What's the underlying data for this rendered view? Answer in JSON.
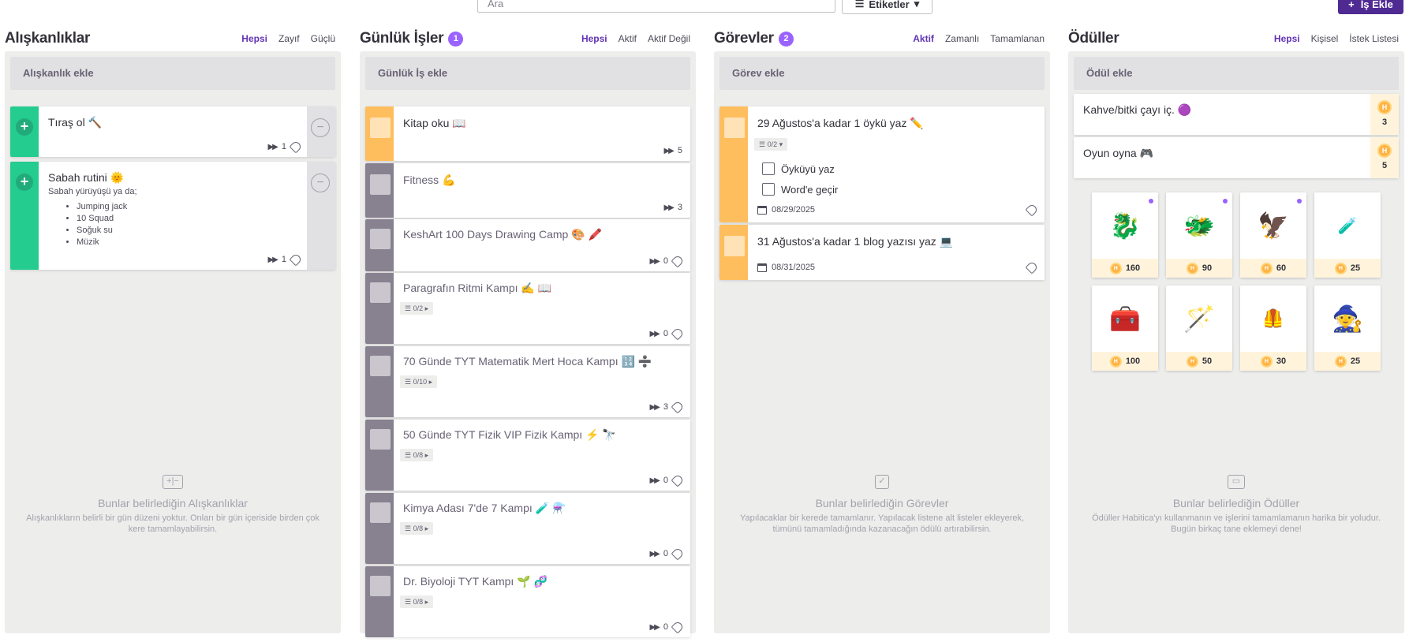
{
  "toolbar": {
    "search_placeholder": "Ara",
    "tags_label": "Etiketler",
    "add_task_label": "İş Ekle"
  },
  "habits": {
    "title": "Alışkanlıklar",
    "filters": [
      "Hepsi",
      "Zayıf",
      "Güçlü"
    ],
    "add_label": "Alışkanlık ekle",
    "items": [
      {
        "title": "Tıraş ol 🔨",
        "count": "1"
      },
      {
        "title": "Sabah rutini 🌞",
        "note": "Sabah yürüyüşü ya da;",
        "list": [
          "Jumping jack",
          "10 Squad",
          "Soğuk su",
          "Müzik"
        ],
        "count": "1"
      }
    ],
    "empty_title": "Bunlar belirlediğin Alışkanlıklar",
    "empty_text": "Alışkanlıkların belirli bir gün düzeni yoktur. Onları bir gün içeriside birden çok kere tamamlayabilirsin."
  },
  "dailies": {
    "title": "Günlük İşler",
    "badge": "1",
    "filters": [
      "Hepsi",
      "Aktif",
      "Aktif Değil"
    ],
    "add_label": "Günlük İş ekle",
    "items": [
      {
        "title": "Kitap oku 📖",
        "streak": "5"
      },
      {
        "title": "Fitness 💪",
        "streak": "3"
      },
      {
        "title": "KeshArt 100 Days Drawing Camp 🎨 🖍️",
        "streak": "0"
      },
      {
        "title": "Paragrafın Ritmi Kampı ✍️ 📖",
        "checklist": "0/2",
        "streak": "0"
      },
      {
        "title": "70 Günde TYT Matematik Mert Hoca Kampı 🔢 ➗",
        "checklist": "0/10",
        "streak": "3"
      },
      {
        "title": "50 Günde TYT Fizik VIP Fizik Kampı ⚡ 🔭",
        "checklist": "0/8",
        "streak": "0"
      },
      {
        "title": "Kimya Adası 7'de 7 Kampı 🧪 ⚗️",
        "checklist": "0/8",
        "streak": "0"
      },
      {
        "title": "Dr. Biyoloji TYT Kampı 🌱 🧬",
        "checklist": "0/8",
        "streak": "0"
      }
    ]
  },
  "todos": {
    "title": "Görevler",
    "badge": "2",
    "filters": [
      "Aktif",
      "Zamanlı",
      "Tamamlanan"
    ],
    "add_label": "Görev ekle",
    "items": [
      {
        "title": "29 Ağustos'a kadar 1 öykü yaz ✏️",
        "checklist": "0/2",
        "subitems": [
          "Öyküyü yaz",
          "Word'e geçir"
        ],
        "date": "08/29/2025"
      },
      {
        "title": "31 Ağustos'a kadar 1 blog yazısı yaz 💻",
        "date": "08/31/2025"
      }
    ],
    "empty_title": "Bunlar belirlediğin Görevler",
    "empty_text": "Yapılacaklar bir kerede tamamlanır. Yapılacak listene alt listeler ekleyerek, tümünü tamamladığında kazanacağın ödülü artırabilirsin."
  },
  "rewards": {
    "title": "Ödüller",
    "filters": [
      "Hepsi",
      "Kişisel",
      "İstek Listesi"
    ],
    "add_label": "Ödül ekle",
    "items": [
      {
        "title": "Kahve/bitki çayı iç. 🟣",
        "price": "3"
      },
      {
        "title": "Oyun oyna 🎮",
        "price": "5"
      }
    ],
    "shop": [
      {
        "icon": "🐉",
        "price": "160"
      },
      {
        "icon": "🐲",
        "price": "90"
      },
      {
        "icon": "🦅",
        "price": "60"
      },
      {
        "icon": "🧪",
        "price": "25"
      },
      {
        "icon": "🧰",
        "price": "100"
      },
      {
        "icon": "🪄",
        "price": "50"
      },
      {
        "icon": "🦺",
        "price": "30"
      },
      {
        "icon": "🧙",
        "price": "25"
      }
    ],
    "empty_title": "Bunlar belirlediğin Ödüller",
    "empty_text": "Ödüller Habitica'yı kullanmanın ve işlerini tamamlamanın harika bir yoludur. Bugün birkaç tane eklemeyi dene!"
  },
  "colors": {
    "brand": "#4f2a93",
    "habit_green": "#24cc8f",
    "daily_yellow": "#ffbe5d",
    "daily_gray": "#878190",
    "accent": "#9a62ff"
  }
}
